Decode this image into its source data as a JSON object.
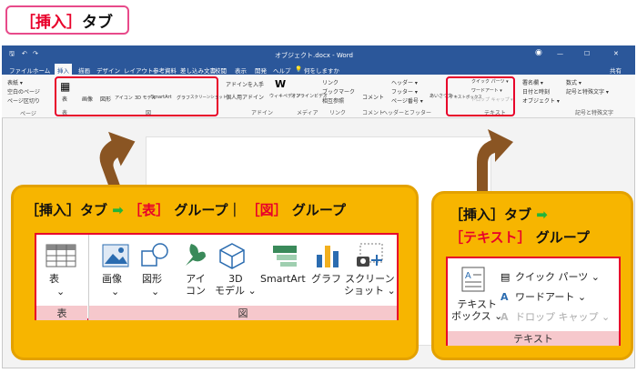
{
  "badge": {
    "bracket_open": "［",
    "tab": "挿入",
    "bracket_close": "］",
    "suffix": "タブ"
  },
  "window": {
    "title": "オブジェクト.docx  -  Word",
    "menu": [
      "ファイル",
      "ホーム",
      "挿入",
      "描画",
      "デザイン",
      "レイアウト",
      "参考資料",
      "差し込み文書",
      "校閲",
      "表示",
      "開発",
      "ヘルプ"
    ],
    "search": "何をしますか",
    "share": "共有",
    "page_group": {
      "items": [
        "表紙 ▾",
        "空白のページ",
        "ページ区切り"
      ],
      "label": "ページ"
    },
    "table_group": {
      "item": "表",
      "label": "表"
    },
    "illust_group": {
      "items": [
        "画像",
        "図形",
        "アイコン",
        "3D モデル",
        "SmartArt",
        "グラフ",
        "スクリーンショット"
      ],
      "label": "図"
    },
    "addin_group": {
      "items": [
        "アドインを入手",
        "個人用アドイン",
        "ウィキペディア"
      ],
      "label": "アドイン"
    },
    "media_group": {
      "item": "オンラインビデオ",
      "label": "メディア"
    },
    "link_group": {
      "items": [
        "リンク",
        "ブックマーク",
        "相互参照"
      ],
      "label": "リンク"
    },
    "comment_group": {
      "item": "コメント",
      "label": "コメント"
    },
    "hf_group": {
      "items": [
        "ヘッダー ▾",
        "フッター ▾",
        "ページ番号 ▾"
      ],
      "label": "ヘッダーとフッター"
    },
    "text_group": {
      "items": [
        "テキストボックス",
        "クイック パーツ ▾",
        "ワードアート ▾",
        "ドロップ キャップ ▾",
        "署名欄 ▾",
        "日付と時刻",
        "オブジェクト ▾",
        "あいさつ文"
      ],
      "label": "テキスト"
    },
    "symbol_group": {
      "items": [
        "数式 ▾",
        "記号と特殊文字 ▾"
      ],
      "label": "記号と特殊文字"
    },
    "window_buttons": [
      "—",
      "☐",
      "✕"
    ]
  },
  "callout_left": {
    "heading": {
      "b1": "［挿入］タブ",
      "arrow": "➡",
      "b2": "［表］",
      "b3": "グループ｜",
      "b4": "［図］",
      "b5": "グループ"
    },
    "table_label": "表",
    "table_group": "表",
    "items": [
      {
        "icon": "image-icon",
        "l1": "画像",
        "l2": "⌄"
      },
      {
        "icon": "shapes-icon",
        "l1": "図形",
        "l2": "⌄"
      },
      {
        "icon": "icons-icon",
        "l1": "アイ",
        "l2": "コン"
      },
      {
        "icon": "3d-model-icon",
        "l1": "3D",
        "l2": "モデル ⌄"
      },
      {
        "icon": "smartart-icon",
        "l1": "SmartArt",
        "l2": ""
      },
      {
        "icon": "chart-icon",
        "l1": "グラフ",
        "l2": ""
      },
      {
        "icon": "screenshot-icon",
        "l1": "スクリーン",
        "l2": "ショット ⌄"
      }
    ],
    "illust_group": "図"
  },
  "callout_right": {
    "heading1": {
      "b1": "［挿入］タブ",
      "arrow": "➡"
    },
    "heading2": {
      "b1": "［テキスト］",
      "b2": "グループ"
    },
    "textbox": {
      "l1": "テキスト",
      "l2": "ボックス ⌄"
    },
    "items": [
      "クイック パーツ ⌄",
      "ワードアート ⌄",
      "ドロップ キャップ ⌄"
    ],
    "group": "テキスト"
  },
  "colors": {
    "word_blue": "#2b579a",
    "accent_red": "#e8002a",
    "callout_orange": "#f7b500",
    "arrow_brown": "#8a5523",
    "arrow_green": "#21b53a",
    "group_pink": "#f6c8cc"
  }
}
